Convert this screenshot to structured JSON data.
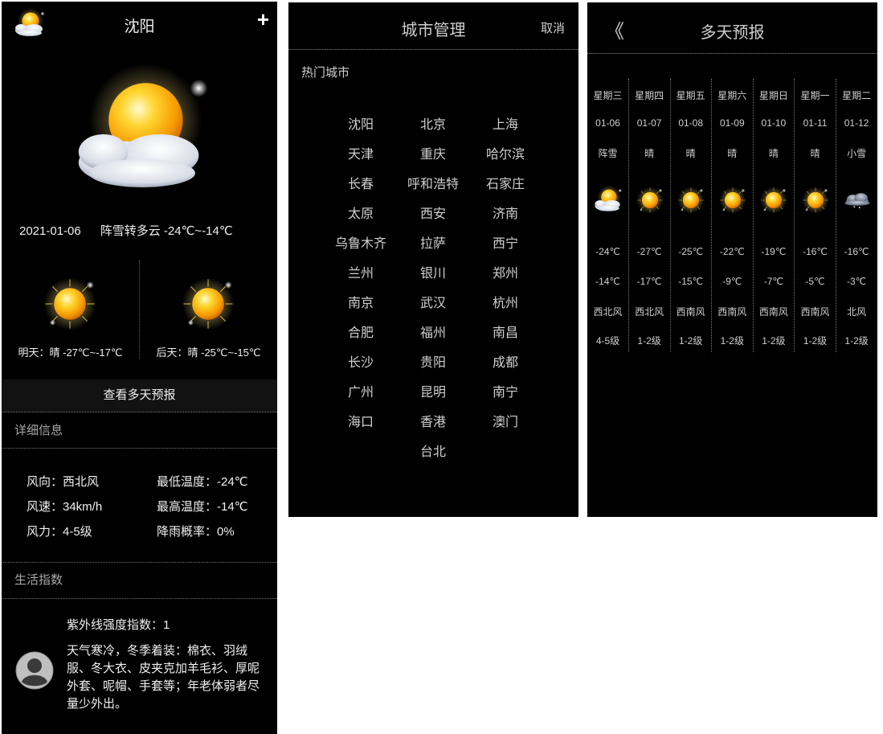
{
  "main": {
    "city": "沈阳",
    "add_label": "+",
    "date": "2021-01-06",
    "summary": "阵雪转多云 -24℃~-14℃",
    "tomorrow": "明天：晴 -27℃~-17℃",
    "after_tomorrow": "后天：晴 -25℃~-15℃",
    "more_button": "查看多天预报",
    "detail_title": "详细信息",
    "details": {
      "wind_dir": "风向：西北风",
      "min_temp": "最低温度：-24℃",
      "wind_speed": "风速：34km/h",
      "max_temp": "最高温度：-14℃",
      "wind_power": "风力：4-5级",
      "rain_prob": "降雨概率：0%"
    },
    "life_title": "生活指数",
    "uv_label": "紫外线强度指数：1",
    "dress_advice": "天气寒冷，冬季着装：棉衣、羽绒服、冬大衣、皮夹克加羊毛衫、厚呢外套、呢帽、手套等；年老体弱者尽量少外出。",
    "icons": {
      "logo": "sun-cloud-icon",
      "today": "sun-cloud-icon",
      "tomorrow": "sun-icon",
      "after_tomorrow": "sun-icon",
      "life": "user-avatar-icon"
    }
  },
  "cities": {
    "title": "城市管理",
    "cancel": "取消",
    "hot_title": "热门城市",
    "list": [
      "沈阳",
      "北京",
      "上海",
      "天津",
      "重庆",
      "哈尔滨",
      "长春",
      "呼和浩特",
      "石家庄",
      "太原",
      "西安",
      "济南",
      "乌鲁木齐",
      "拉萨",
      "西宁",
      "兰州",
      "银川",
      "郑州",
      "南京",
      "武汉",
      "杭州",
      "合肥",
      "福州",
      "南昌",
      "长沙",
      "贵阳",
      "成都",
      "广州",
      "昆明",
      "南宁",
      "海口",
      "香港",
      "澳门",
      "台北"
    ]
  },
  "forecast": {
    "back": "《",
    "title": "多天预报",
    "days": [
      {
        "weekday": "星期三",
        "date": "01-06",
        "weather": "阵雪",
        "icon": "sun-cloud-icon",
        "low": "-24℃",
        "high": "-14℃",
        "wind": "西北风",
        "level": "4-5级"
      },
      {
        "weekday": "星期四",
        "date": "01-07",
        "weather": "晴",
        "icon": "sun-icon",
        "low": "-27℃",
        "high": "-17℃",
        "wind": "西北风",
        "level": "1-2级"
      },
      {
        "weekday": "星期五",
        "date": "01-08",
        "weather": "晴",
        "icon": "sun-icon",
        "low": "-25℃",
        "high": "-15℃",
        "wind": "西南风",
        "level": "1-2级"
      },
      {
        "weekday": "星期六",
        "date": "01-09",
        "weather": "晴",
        "icon": "sun-icon",
        "low": "-22℃",
        "high": "-9℃",
        "wind": "西南风",
        "level": "1-2级"
      },
      {
        "weekday": "星期日",
        "date": "01-10",
        "weather": "晴",
        "icon": "sun-icon",
        "low": "-19℃",
        "high": "-7℃",
        "wind": "西南风",
        "level": "1-2级"
      },
      {
        "weekday": "星期一",
        "date": "01-11",
        "weather": "晴",
        "icon": "sun-icon",
        "low": "-16℃",
        "high": "-5℃",
        "wind": "西南风",
        "level": "1-2级"
      },
      {
        "weekday": "星期二",
        "date": "01-12",
        "weather": "小雪",
        "icon": "snow-cloud-icon",
        "low": "-16℃",
        "high": "-3℃",
        "wind": "北风",
        "level": "1-2级"
      }
    ]
  }
}
